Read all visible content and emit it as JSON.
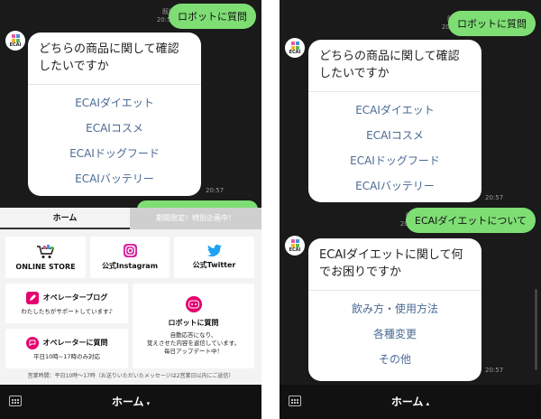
{
  "left": {
    "user_message": {
      "text": "ロボットに質問",
      "read": "既読",
      "time": "20:57"
    },
    "bot_card": {
      "question": "どちらの商品に関して確認したいですか",
      "options": [
        "ECAIダイエット",
        "ECAIコスメ",
        "ECAIドッグフード",
        "ECAIバッテリー"
      ],
      "time": "20:57"
    },
    "rich_menu": {
      "tab_home": "ホーム",
      "tab_limited": "期間限定！特別企画中！",
      "tiles": {
        "online_store": "ONLINE STORE",
        "instagram": "公式Instagram",
        "twitter": "公式Twitter",
        "blog": {
          "label": "オペレーターブログ",
          "sub": "わたしたちがサポートしています♪"
        },
        "robot": {
          "label": "ロボットに質問",
          "sub": "自動応答になり、\n覚えさせた内容を返信しています。\n毎日アップデート中！"
        },
        "operator": {
          "label": "オペレーターに質問",
          "sub": "平日10時~17時のみ対応"
        }
      },
      "footnote": "営業時間：平日10時～17時（お送りいただいたメッセージは2営業日以内にご返信）"
    },
    "bottom_bar": {
      "menu_label": "ホーム",
      "arrow": "▾"
    }
  },
  "right": {
    "user_message_1": {
      "text": "ロボットに質問",
      "read": "既読",
      "time": "20:57"
    },
    "bot_card_1": {
      "question": "どちらの商品に関して確認したいですか",
      "options": [
        "ECAIダイエット",
        "ECAIコスメ",
        "ECAIドッグフード",
        "ECAIバッテリー"
      ],
      "time": "20:57"
    },
    "user_message_2": {
      "text": "ECAIダイエットについて",
      "read": "既読",
      "time": "20:57"
    },
    "bot_card_2": {
      "question": "ECAIダイエットに関して何でお困りですか",
      "options": [
        "飲み方・使用方法",
        "各種変更",
        "その他"
      ],
      "time": "20:57"
    },
    "bottom_bar": {
      "menu_label": "ホーム",
      "arrow": "▴"
    }
  },
  "avatar": {
    "logo_text": "ECAI",
    "colors": [
      "#e85aa0",
      "#4a90d9",
      "#f2b233",
      "#5cb85c"
    ]
  },
  "colors": {
    "user_bubble": "#7ede74",
    "option_text": "#4b6a93",
    "accent_pink": "#e4006f",
    "chat_bg": "#1a1a1a"
  }
}
